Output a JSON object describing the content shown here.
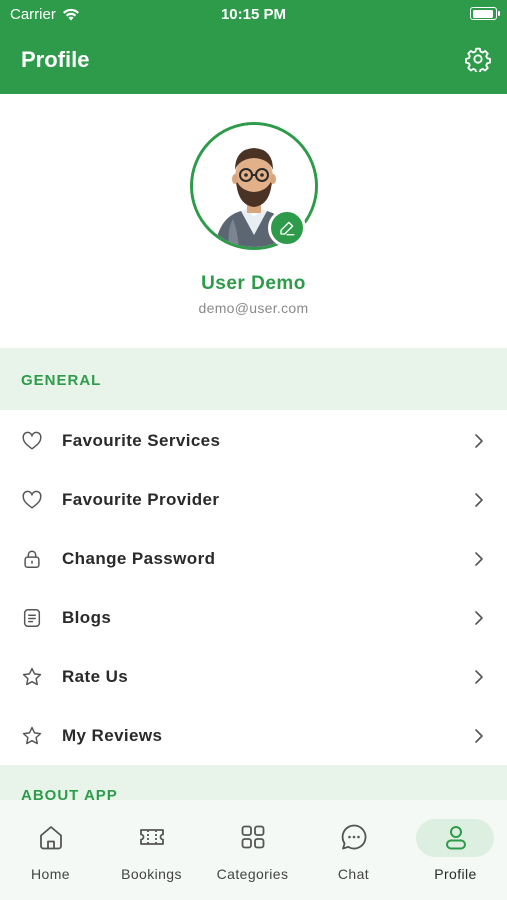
{
  "status_bar": {
    "carrier": "Carrier",
    "time": "10:15 PM"
  },
  "header": {
    "title": "Profile",
    "settings_icon": "gear-icon"
  },
  "user": {
    "name": "User Demo",
    "email": "demo@user.com"
  },
  "sections": {
    "general": "GENERAL",
    "about": "ABOUT APP"
  },
  "menu": [
    {
      "label": "Favourite Services",
      "icon": "heart-icon"
    },
    {
      "label": "Favourite Provider",
      "icon": "heart-icon"
    },
    {
      "label": "Change Password",
      "icon": "lock-icon"
    },
    {
      "label": "Blogs",
      "icon": "document-icon"
    },
    {
      "label": "Rate Us",
      "icon": "star-icon"
    },
    {
      "label": "My Reviews",
      "icon": "star-icon"
    }
  ],
  "tabs": [
    {
      "label": "Home",
      "icon": "home-icon"
    },
    {
      "label": "Bookings",
      "icon": "ticket-icon"
    },
    {
      "label": "Categories",
      "icon": "grid-icon"
    },
    {
      "label": "Chat",
      "icon": "chat-icon"
    },
    {
      "label": "Profile",
      "icon": "user-icon",
      "active": true
    }
  ],
  "colors": {
    "brand": "#2e9b4a",
    "section_bg": "#e8f4ea",
    "tabbar_bg": "#f4f9f5"
  }
}
